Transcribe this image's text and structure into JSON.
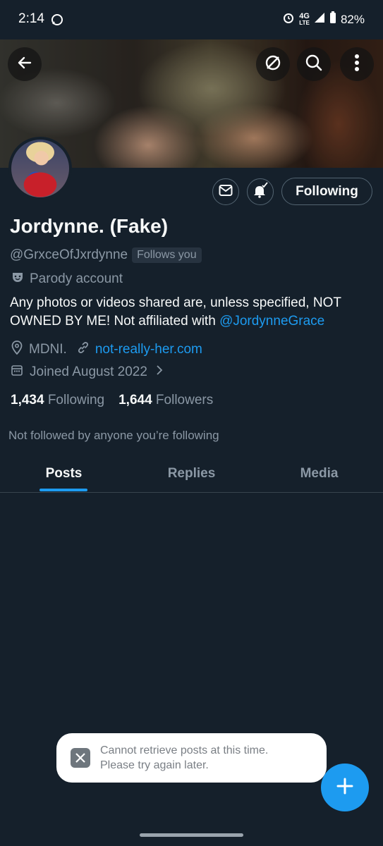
{
  "status_bar": {
    "time": "2:14",
    "network": "4G",
    "network_sub": "LTE",
    "battery": "82%"
  },
  "banner": {
    "icons": [
      "back-arrow-icon",
      "dismiss-circle-icon",
      "search-icon",
      "more-vertical-icon"
    ]
  },
  "profile": {
    "display_name": "Jordynne. (Fake)",
    "handle": "@GrxceOfJxrdynne",
    "follows_you": "Follows you",
    "parody_label": "Parody account",
    "bio_text": "Any photos or videos shared are, unless specified, NOT OWNED BY ME! Not affiliated with ",
    "bio_mention": "@JordynneGrace",
    "location": "MDNI.",
    "website": "not-really-her.com",
    "joined": "Joined August 2022",
    "following_count": "1,434",
    "following_label": "Following",
    "followers_count": "1,644",
    "followers_label": "Followers",
    "not_followed_text": "Not followed by anyone you’re following"
  },
  "actions": {
    "follow_state": "Following"
  },
  "tabs": [
    {
      "label": "Posts",
      "active": true
    },
    {
      "label": "Replies",
      "active": false
    },
    {
      "label": "Media",
      "active": false
    }
  ],
  "toast": {
    "line1": "Cannot retrieve posts at this time.",
    "line2": "Please try again later."
  },
  "colors": {
    "background": "#15202b",
    "accent": "#1d9bf0",
    "muted": "#8b98a5"
  }
}
